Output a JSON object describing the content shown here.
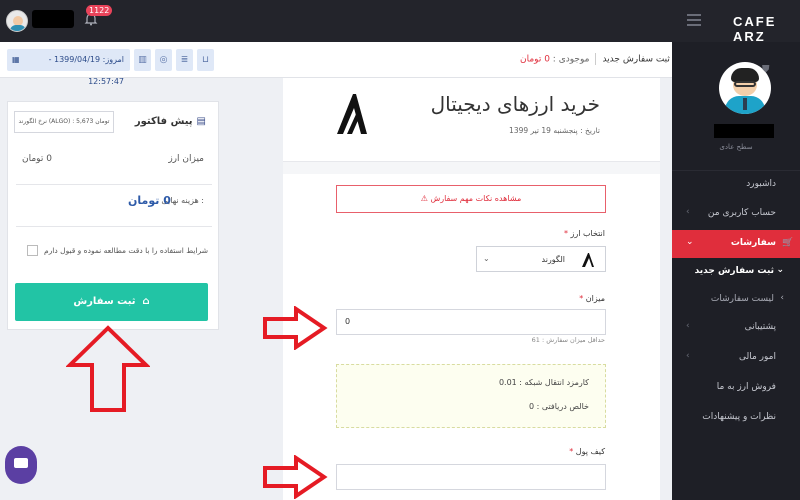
{
  "topbar": {
    "notification_count": "1122",
    "logo": "CAFE ARZ"
  },
  "sidebar": {
    "role": "سطح عادی",
    "items": [
      {
        "label": "داشبورد"
      },
      {
        "label": "حساب کاربری من"
      },
      {
        "label": "سفارشات"
      },
      {
        "label": "پشتیبانی"
      },
      {
        "label": "امور مالی"
      },
      {
        "label": "فروش ارز به ما"
      },
      {
        "label": "نظرات و پیشنهادات"
      }
    ],
    "sub_items": [
      {
        "label": "ثبت سفارش جدید"
      },
      {
        "label": "لیست سفارشات"
      }
    ]
  },
  "toolbar": {
    "date_text": "امروز: 1399/04/19 - 12:57:47",
    "breadcrumb": "ثبت سفارش جدید",
    "balance_label": "موجودی :",
    "balance_value": "0 تومان"
  },
  "invoice": {
    "title": "پیش فاکتور",
    "rate": "نرخ الگورند (ALGO) : 5,673 تومان",
    "amount_label": "میزان ارز",
    "amount_value": "0 تومان",
    "final_label": "هزینه نهایی :",
    "final_value": "0 تومان",
    "terms": "شرایط استفاده را با دقت مطالعه نموده و قبول دارم",
    "submit": "ثبت سفارش"
  },
  "main": {
    "title": "خرید ارزهای دیجیتال",
    "date": "تاریخ : پنجشنبه 19 تیر 1399",
    "alert": "مشاهده نکات مهم سفارش",
    "currency_label": "انتخاب ارز",
    "currency_value": "الگورند",
    "amount_label": "میزان",
    "amount_value": "0",
    "min_hint": "حداقل میزان سفارش : 61",
    "fee_text": "کارمزد انتقال شبکه : 0.01",
    "net_text": "خالص دریافتی : 0",
    "wallet_label": "کیف پول",
    "required_mark": "*"
  },
  "colors": {
    "accent_red": "#e02e3c",
    "teal": "#22c4a5",
    "dark_bg": "#23242b"
  }
}
